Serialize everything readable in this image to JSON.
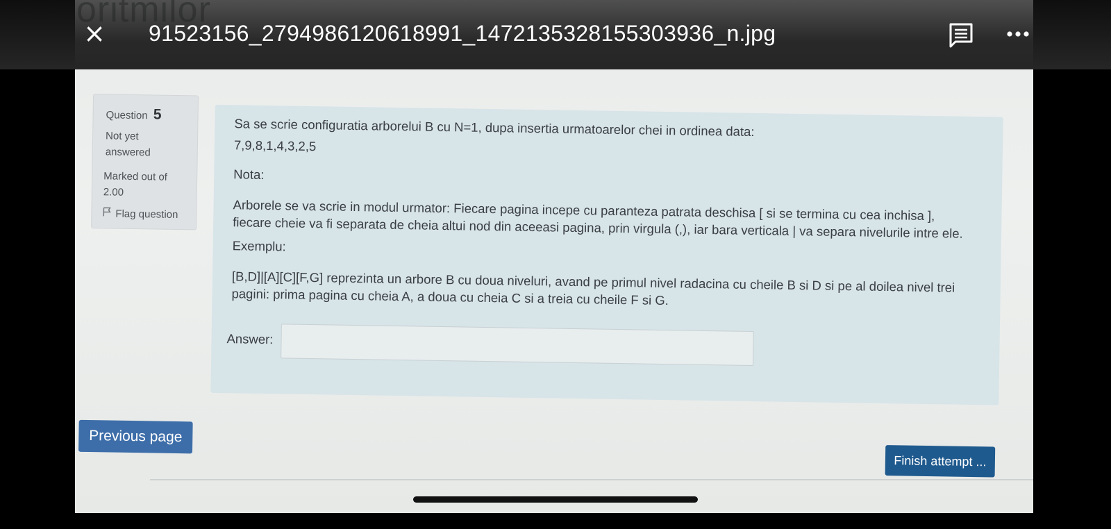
{
  "viewer": {
    "filename": "91523156_2794986120618991_1472135328155303936_n.jpg",
    "close_icon": "×",
    "background_word": "oritmilor"
  },
  "question": {
    "label": "Question",
    "number": "5",
    "state_line1": "Not yet",
    "state_line2": "answered",
    "marked_line1": "Marked out of",
    "marked_line2": "2.00",
    "flag_label": "Flag question",
    "text1": "Sa se scrie configuratia arborelui B cu N=1, dupa insertia urmatoarelor chei in ordinea data:",
    "text2": "7,9,8,1,4,3,2,5",
    "text3": "Nota:",
    "text4": "Arborele se va scrie in modul urmator: Fiecare pagina incepe cu paranteza patrata deschisa [ si se termina cu cea inchisa ], fiecare cheie va fi separata de cheia altui nod din aceeasi pagina, prin virgula (,), iar bara verticala | va separa nivelurile intre ele.",
    "text5": "Exemplu:",
    "text6": "[B,D]|[A][C][F,G] reprezinta un arbore B cu doua niveluri, avand pe primul nivel radacina cu cheile B si D si pe al doilea nivel trei pagini: prima pagina cu cheia A, a doua cu cheia C si a treia cu cheile F si G.",
    "answer_label": "Answer:",
    "answer_value": ""
  },
  "buttons": {
    "previous": "Previous page",
    "finish": "Finish attempt ..."
  }
}
